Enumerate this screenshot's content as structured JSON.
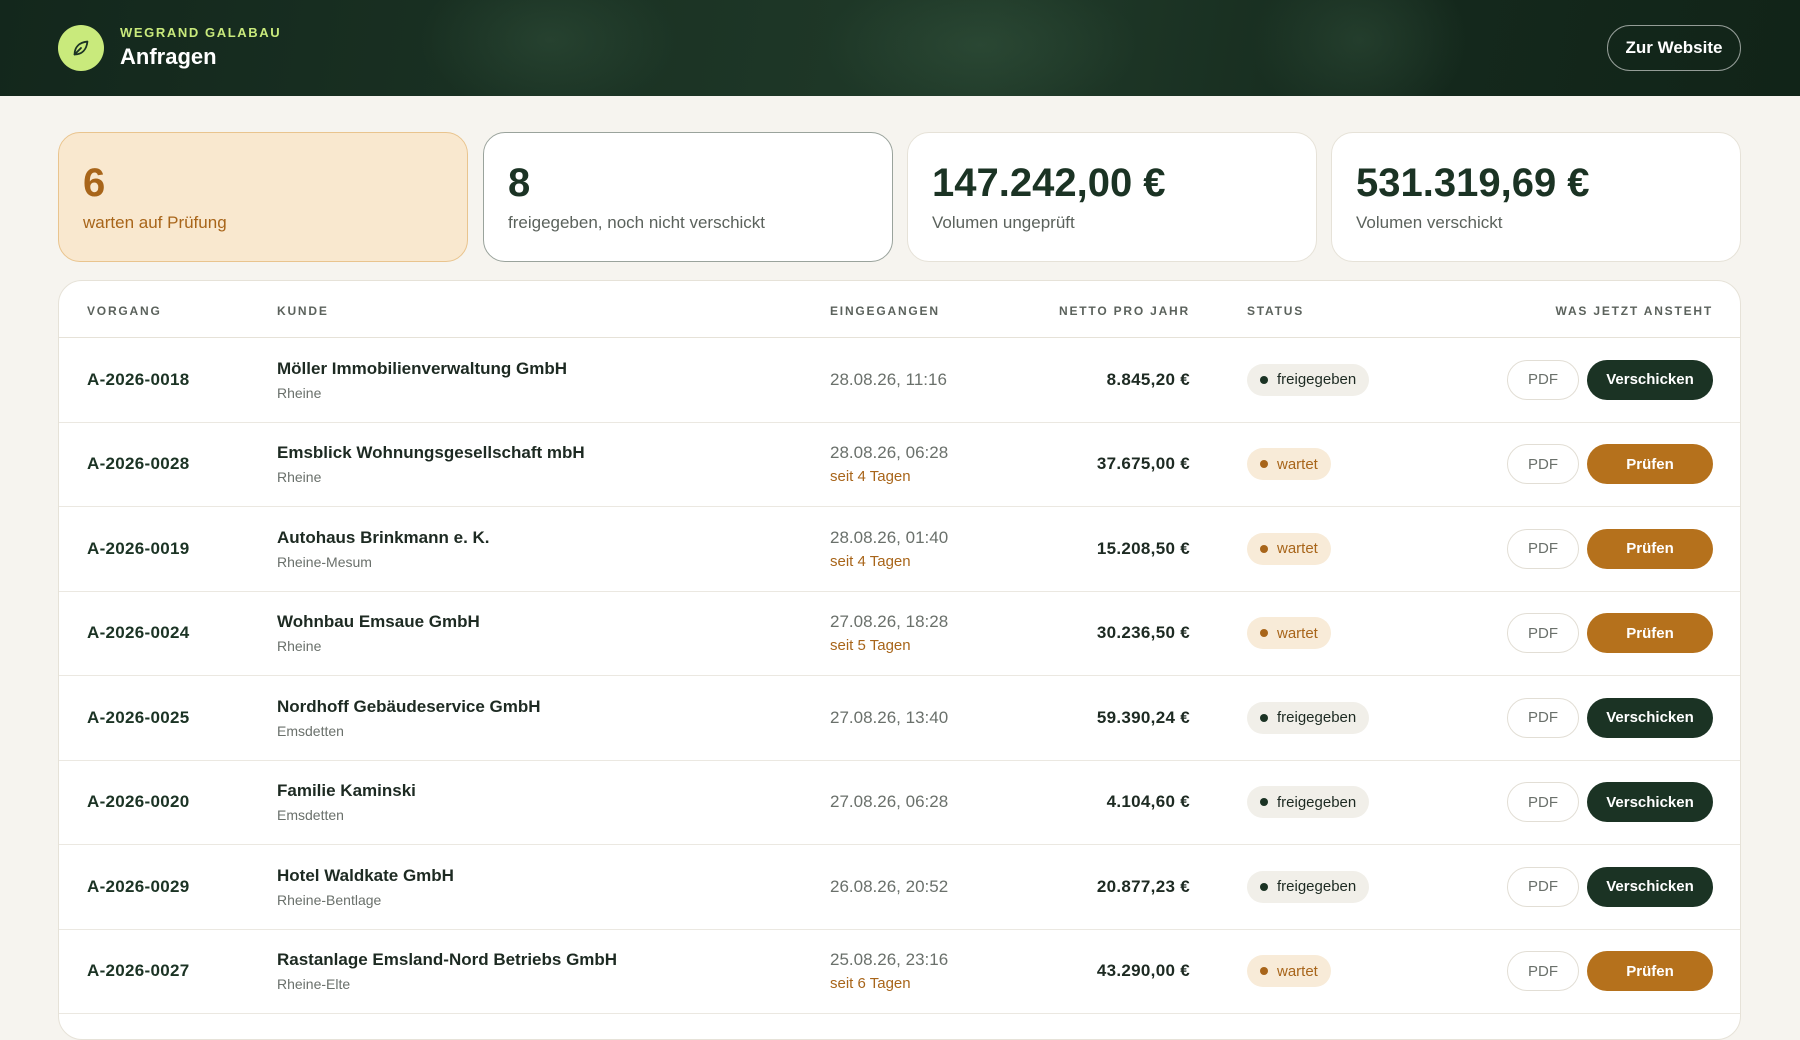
{
  "header": {
    "brand_small": "WEGRAND GALABAU",
    "title": "Anfragen",
    "website_button": "Zur Website",
    "logo_icon": "leaf-icon"
  },
  "stats": [
    {
      "value": "6",
      "label": "warten auf Prüfung"
    },
    {
      "value": "8",
      "label": "freigegeben, noch nicht verschickt"
    },
    {
      "value": "147.242,00 €",
      "label": "Volumen ungeprüft"
    },
    {
      "value": "531.319,69 €",
      "label": "Volumen verschickt"
    }
  ],
  "table": {
    "columns": {
      "vorgang": "VORGANG",
      "kunde": "KUNDE",
      "eingegangen": "EINGEGANGEN",
      "netto": "NETTO PRO JAHR",
      "status": "STATUS",
      "aktion": "WAS JETZT ANSTEHT"
    },
    "pdf_label": "PDF",
    "rows": [
      {
        "id": "A-2026-0018",
        "name": "Möller Immobilienverwaltung GmbH",
        "ort": "Rheine",
        "date": "28.08.26, 11:16",
        "since": "",
        "amount": "8.845,20 €",
        "status": "freigegeben",
        "action": "Verschicken"
      },
      {
        "id": "A-2026-0028",
        "name": "Emsblick Wohnungsgesellschaft mbH",
        "ort": "Rheine",
        "date": "28.08.26, 06:28",
        "since": "seit 4 Tagen",
        "amount": "37.675,00 €",
        "status": "wartet",
        "action": "Prüfen"
      },
      {
        "id": "A-2026-0019",
        "name": "Autohaus Brinkmann e. K.",
        "ort": "Rheine-Mesum",
        "date": "28.08.26, 01:40",
        "since": "seit 4 Tagen",
        "amount": "15.208,50 €",
        "status": "wartet",
        "action": "Prüfen"
      },
      {
        "id": "A-2026-0024",
        "name": "Wohnbau Emsaue GmbH",
        "ort": "Rheine",
        "date": "27.08.26, 18:28",
        "since": "seit 5 Tagen",
        "amount": "30.236,50 €",
        "status": "wartet",
        "action": "Prüfen"
      },
      {
        "id": "A-2026-0025",
        "name": "Nordhoff Gebäudeservice GmbH",
        "ort": "Emsdetten",
        "date": "27.08.26, 13:40",
        "since": "",
        "amount": "59.390,24 €",
        "status": "freigegeben",
        "action": "Verschicken"
      },
      {
        "id": "A-2026-0020",
        "name": "Familie Kaminski",
        "ort": "Emsdetten",
        "date": "27.08.26, 06:28",
        "since": "",
        "amount": "4.104,60 €",
        "status": "freigegeben",
        "action": "Verschicken"
      },
      {
        "id": "A-2026-0029",
        "name": "Hotel Waldkate GmbH",
        "ort": "Rheine-Bentlage",
        "date": "26.08.26, 20:52",
        "since": "",
        "amount": "20.877,23 €",
        "status": "freigegeben",
        "action": "Verschicken"
      },
      {
        "id": "A-2026-0027",
        "name": "Rastanlage Emsland-Nord Betriebs GmbH",
        "ort": "Rheine-Elte",
        "date": "25.08.26, 23:16",
        "since": "seit 6 Tagen",
        "amount": "43.290,00 €",
        "status": "wartet",
        "action": "Prüfen"
      }
    ]
  },
  "colors": {
    "header_bg": "#13271c",
    "accent_green": "#c9ea7c",
    "dark_green": "#1b3324",
    "warn_orange": "#b5711c"
  }
}
